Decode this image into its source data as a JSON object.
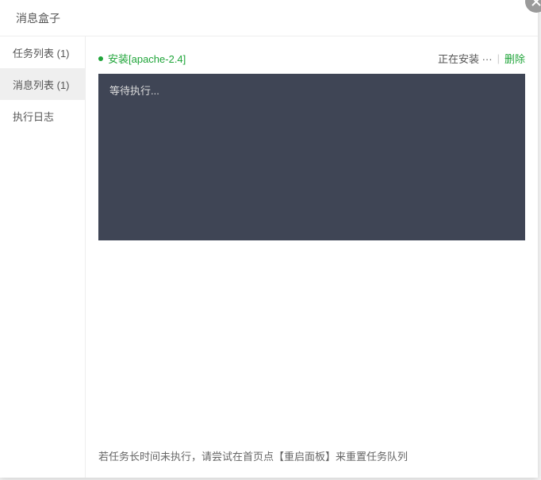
{
  "header": {
    "title": "消息盒子"
  },
  "sidebar": {
    "items": [
      {
        "label": "任务列表 (1)"
      },
      {
        "label": "消息列表 (1)"
      },
      {
        "label": "执行日志"
      }
    ]
  },
  "task": {
    "name": "安装[apache-2.4]",
    "status": "正在安装 ···",
    "delete_label": "删除"
  },
  "terminal": {
    "text": "等待执行..."
  },
  "footer": {
    "tip": "若任务长时间未执行，请尝试在首页点【重启面板】来重置任务队列"
  }
}
